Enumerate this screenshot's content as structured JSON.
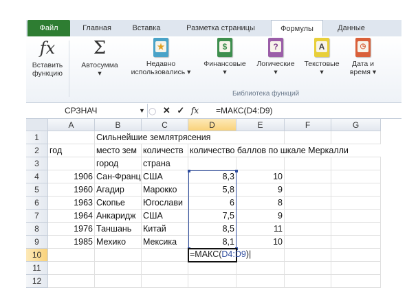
{
  "ribbon": {
    "tabs": [
      "Файл",
      "Главная",
      "Вставка",
      "Разметка страницы",
      "Формулы",
      "Данные"
    ],
    "active_tab": "Формулы",
    "buttons": {
      "insert_function": [
        "Вставить",
        "функцию"
      ],
      "autosum": [
        "Автосумма",
        "▾"
      ],
      "recent": [
        "Недавно",
        "использовались ▾"
      ],
      "financial": [
        "Финансовые",
        "▾"
      ],
      "logical": [
        "Логические",
        "▾"
      ],
      "text": [
        "Текстовые",
        "▾"
      ],
      "datetime": [
        "Дата и",
        "время ▾"
      ]
    },
    "group_label": "Библиотека функций",
    "icons": {
      "insert_function": "fx",
      "autosum": "Σ",
      "logical": "?",
      "text": "A"
    },
    "colors": {
      "file_tab": "#2e7d32",
      "range_border": "#2f4d9e",
      "header_selected": "#f9d27a"
    }
  },
  "formula_bar": {
    "name_box": "СРЗНАЧ",
    "fx_label": "fx",
    "formula": "=МАКС(D4:D9)"
  },
  "sheet": {
    "columns": [
      "A",
      "B",
      "C",
      "D",
      "E",
      "F",
      "G"
    ],
    "rows": [
      "1",
      "2",
      "3",
      "4",
      "5",
      "6",
      "7",
      "8",
      "9",
      "10",
      "11",
      "12"
    ],
    "cells": {
      "B1": "Сильнейшие землятрясения",
      "A2": "год",
      "B2": "место зем",
      "C2": "количеств",
      "D2": "количество баллов по шкале Меркалли",
      "B3": "город",
      "C3": "страна",
      "A4": "1906",
      "B4": "Сан-Франц",
      "C4": "США",
      "D4": "8,3",
      "E4": "10",
      "A5": "1960",
      "B5": "Агадир",
      "C5": "Марокко",
      "D5": "5,8",
      "E5": "9",
      "A6": "1963",
      "B6": "Скопье",
      "C6": "Югослави",
      "D6": "6",
      "E6": "8",
      "A7": "1964",
      "B7": "Анкаридж",
      "C7": "США",
      "D7": "7,5",
      "E7": "9",
      "A8": "1976",
      "B8": "Таншань",
      "C8": "Китай",
      "D8": "8,5",
      "E8": "11",
      "A9": "1985",
      "B9": "Мехико",
      "C9": "Мексика",
      "D9": "8,1",
      "E9": "10"
    },
    "edit": {
      "cell": "D10",
      "prefix": "=МАКС(",
      "ref": "D4:D9",
      "suffix": ")"
    },
    "selected_column": "D",
    "selected_row": "10"
  }
}
